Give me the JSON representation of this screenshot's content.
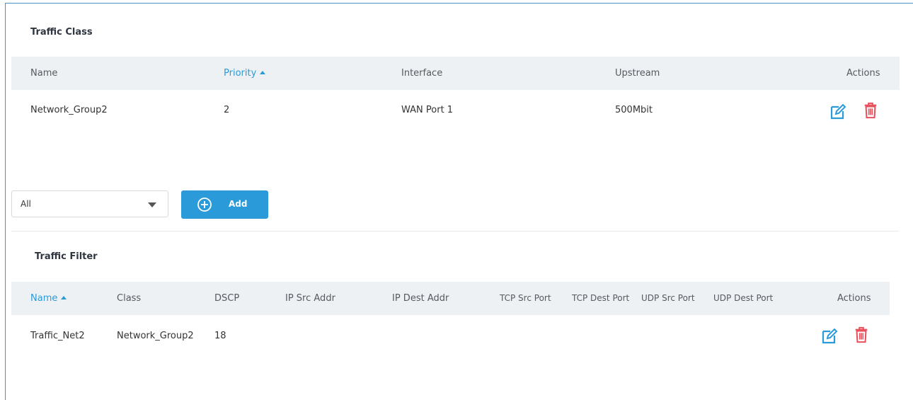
{
  "traffic_class": {
    "title": "Traffic Class",
    "columns": {
      "name": "Name",
      "priority": "Priority",
      "interface": "Interface",
      "upstream": "Upstream",
      "actions": "Actions"
    },
    "rows": [
      {
        "name": "Network_Group2",
        "priority": "2",
        "interface": "WAN Port 1",
        "upstream": "500Mbit"
      }
    ]
  },
  "filter_select": {
    "value": "All"
  },
  "add_button": {
    "label": "Add"
  },
  "traffic_filter": {
    "title": "Traffic Filter",
    "columns": {
      "name": "Name",
      "class": "Class",
      "dscp": "DSCP",
      "ip_src": "IP Src Addr",
      "ip_dest": "IP Dest Addr",
      "tcp_src": "TCP Src Port",
      "tcp_dest": "TCP Dest Port",
      "udp_src": "UDP Src Port",
      "udp_dest": "UDP Dest Port",
      "actions": "Actions"
    },
    "rows": [
      {
        "name": "Traffic_Net2",
        "class": "Network_Group2",
        "dscp": "18"
      }
    ]
  },
  "icons": {
    "edit": "edit-icon",
    "delete": "trash-icon",
    "add": "plus-circle-icon",
    "sort": "sort-ascending-caret"
  },
  "colors": {
    "accent": "#2b9ad8",
    "delete": "#e8505b",
    "header_bg": "#eef1f4",
    "frame_border": "#4a90c8"
  }
}
